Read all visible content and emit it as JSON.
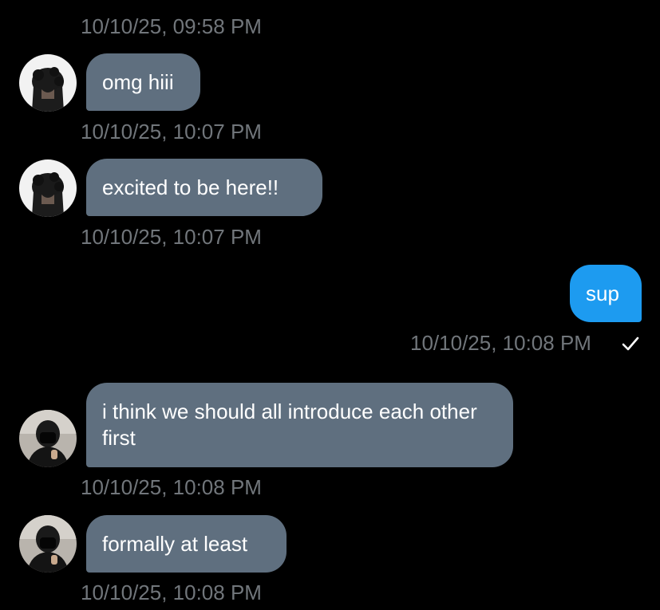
{
  "colors": {
    "background": "#000000",
    "incoming_bubble": "#5f6f7f",
    "outgoing_bubble": "#1d9bf0",
    "timestamp": "#71767b",
    "text": "#ffffff"
  },
  "conversation": {
    "top_timestamp": "10/10/25, 09:58 PM",
    "messages": [
      {
        "direction": "incoming",
        "avatar": "avatar-dark-hair-bun",
        "text": "omg hiii",
        "timestamp": "10/10/25, 10:07 PM"
      },
      {
        "direction": "incoming",
        "avatar": "avatar-dark-hair-bun",
        "text": "excited to be here!!",
        "timestamp": "10/10/25, 10:07 PM"
      },
      {
        "direction": "outgoing",
        "text": "sup",
        "timestamp": "10/10/25, 10:08 PM",
        "status_icon": "checkmark-icon"
      },
      {
        "direction": "incoming",
        "avatar": "avatar-masked-person",
        "text": "i think we should all introduce each other first",
        "timestamp": "10/10/25, 10:08 PM"
      },
      {
        "direction": "incoming",
        "avatar": "avatar-masked-person",
        "text": "formally at least",
        "timestamp": "10/10/25, 10:08 PM"
      }
    ]
  }
}
